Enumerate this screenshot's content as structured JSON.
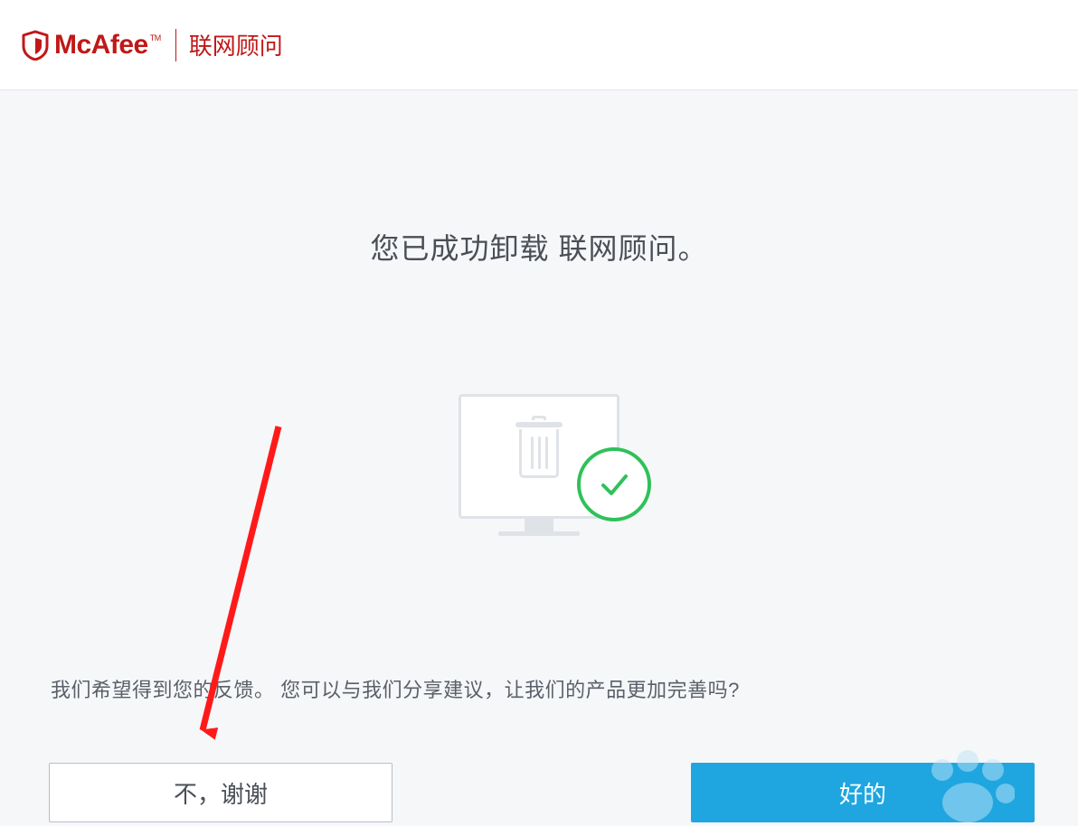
{
  "header": {
    "brand": "McAfee",
    "tm": "TM",
    "product": "联网顾问"
  },
  "main": {
    "title": "您已成功卸载 联网顾问。"
  },
  "feedback": {
    "text": "我们希望得到您的反馈。 您可以与我们分享建议，让我们的产品更加完善吗?"
  },
  "buttons": {
    "no_label": "不，谢谢",
    "yes_label": "好的"
  },
  "icons": {
    "shield": "mcafee-shield-icon",
    "trash": "trash-icon",
    "check": "checkmark-icon"
  }
}
